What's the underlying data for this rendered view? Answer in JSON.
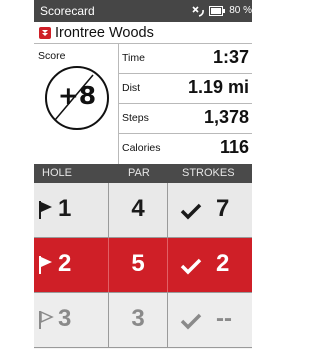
{
  "status_bar": {
    "title": "Scorecard",
    "battery_text": "80 %",
    "icons": [
      "signal-icon",
      "battery-icon"
    ]
  },
  "course": {
    "name": "Irontree Woods",
    "badge_icon": "flag-badge-icon",
    "accent": "#cf1f27"
  },
  "score": {
    "label": "Score",
    "value": "+8"
  },
  "stats": [
    {
      "label": "Time",
      "value": "1:37"
    },
    {
      "label": "Dist",
      "value": "1.19 mi"
    },
    {
      "label": "Steps",
      "value": "1,378"
    },
    {
      "label": "Calories",
      "value": "116"
    }
  ],
  "columns": {
    "hole": "HOLE",
    "par": "PAR",
    "strokes": "STROKES"
  },
  "holes": [
    {
      "hole": "1",
      "par": "4",
      "strokes": "7",
      "state": "normal"
    },
    {
      "hole": "2",
      "par": "5",
      "strokes": "2",
      "state": "active"
    },
    {
      "hole": "3",
      "par": "3",
      "strokes": "--",
      "state": "dim"
    }
  ],
  "colors": {
    "status_bar": "#464646",
    "header_bar": "#4a4a4a",
    "active_row": "#cf1f27"
  }
}
